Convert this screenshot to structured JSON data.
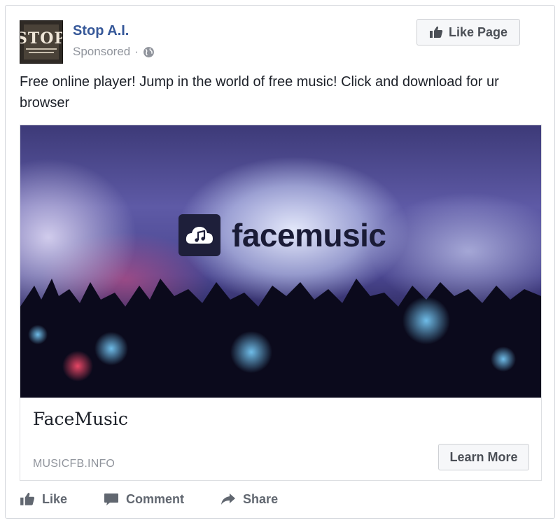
{
  "post": {
    "page_name": "Stop A.I.",
    "sponsored_label": "Sponsored",
    "separator": "·",
    "audience_icon": "globe-icon",
    "avatar_text": "STOP",
    "like_page_label": "Like Page",
    "message": "Free online player! Jump in the world of free music! Click and download for ur browser"
  },
  "card": {
    "image_brand": "facemusic",
    "title": "FaceMusic",
    "domain": "MUSICFB.INFO",
    "cta_label": "Learn More"
  },
  "actions": [
    {
      "label": "Like",
      "icon": "thumbs-up-icon"
    },
    {
      "label": "Comment",
      "icon": "comment-icon"
    },
    {
      "label": "Share",
      "icon": "share-arrow-icon"
    }
  ],
  "colors": {
    "link_blue": "#365899",
    "meta_gray": "#90949c",
    "button_text": "#4b4f56",
    "border": "#d3d6db"
  }
}
